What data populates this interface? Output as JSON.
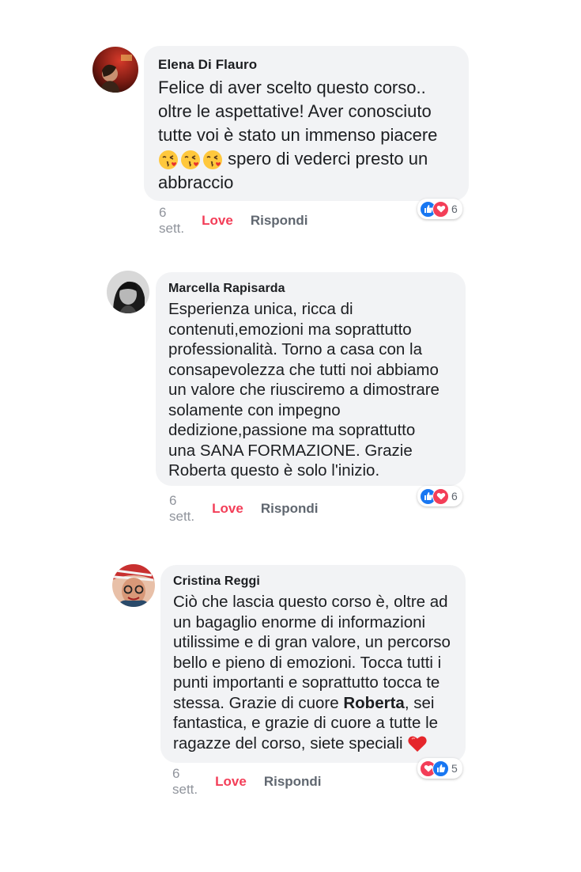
{
  "comments": [
    {
      "author": "Elena Di Flauro",
      "text_before_emoji": "Felice di aver scelto questo corso..\noltre le aspettative! Aver conosciuto\ntutte voi è stato un immenso piacere",
      "emojis": [
        "kissing-face-emoji",
        "kissing-face-emoji",
        "kissing-face-emoji"
      ],
      "text_after_emoji": " spero di vederci presto un\nabbraccio",
      "time": "6 sett.",
      "love_label": "Love",
      "reply_label": "Rispondi",
      "reaction_icons": [
        "like-icon",
        "heart-icon"
      ],
      "reaction_count": "6"
    },
    {
      "author": "Marcella Rapisarda",
      "text": "Esperienza unica, ricca di\ncontenuti,emozioni ma soprattutto\nprofessionalità. Torno a casa con la\nconsapevolezza che tutti noi abbiamo\nun valore che riusciremo a dimostrare\nsolamente con impegno\ndedizione,passione ma soprattutto\nuna SANA FORMAZIONE.  Grazie\nRoberta questo è solo l'inizio.",
      "time": "6 sett.",
      "love_label": "Love",
      "reply_label": "Rispondi",
      "reaction_icons": [
        "like-icon",
        "heart-icon"
      ],
      "reaction_count": "6"
    },
    {
      "author": "Cristina Reggi",
      "text_before_bold": "Ciò che lascia questo corso è, oltre ad\nun bagaglio enorme di informazioni\nutilissime e di gran valore, un percorso\nbello e pieno di emozioni. Tocca tutti i\npunti importanti e soprattutto tocca te\nstessa. Grazie di cuore ",
      "bold_text": "Roberta",
      "text_after_bold": ", sei\nfantastica, e grazie di cuore a tutte le\nragazze del corso, siete speciali ",
      "emojis": [
        "red-heart-emoji"
      ],
      "time": "6 sett.",
      "love_label": "Love",
      "reply_label": "Rispondi",
      "reaction_icons": [
        "heart-icon",
        "like-icon"
      ],
      "reaction_count": "5"
    }
  ],
  "colors": {
    "bubble": "#f2f3f5",
    "love": "#f33e58",
    "like": "#1877f2",
    "muted": "#90949c"
  }
}
